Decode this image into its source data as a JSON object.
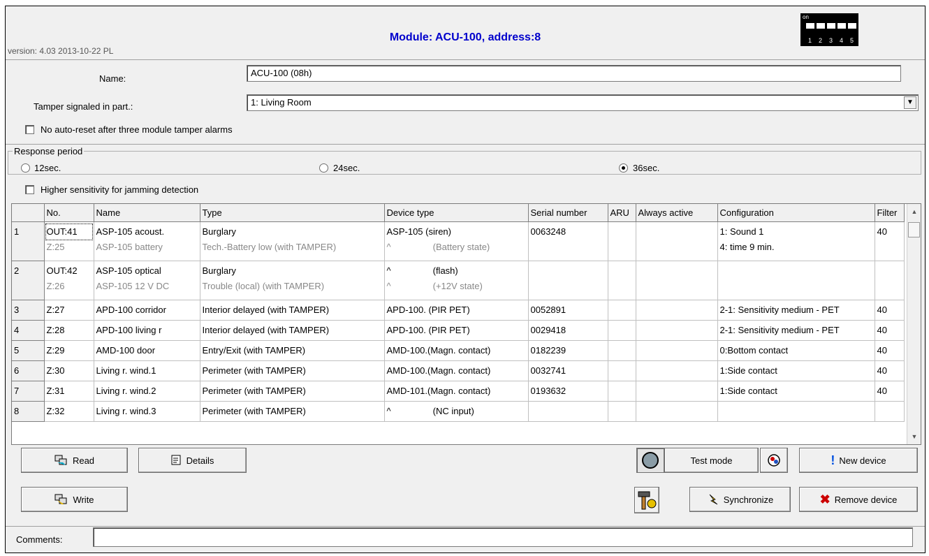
{
  "header": {
    "title": "Module: ACU-100, address:8",
    "version": "version: 4.03 2013-10-22 PL",
    "dip": {
      "on_label": "on",
      "numbers": [
        "1",
        "2",
        "3",
        "4",
        "5"
      ]
    }
  },
  "form": {
    "name_label": "Name:",
    "name_value": "ACU-100  (08h)",
    "tamper_label": "Tamper signaled in part.:",
    "tamper_value": "1: Living Room",
    "no_autoreset_label": "No auto-reset after three module tamper alarms",
    "response_period_label": "Response period",
    "response_options": [
      "12sec.",
      "24sec.",
      "36sec."
    ],
    "response_selected": "36sec.",
    "higher_sensitivity_label": "Higher sensitivity for jamming detection"
  },
  "table": {
    "headers": [
      "",
      "No.",
      "Name",
      "Type",
      "Device type",
      "Serial number",
      "ARU",
      "Always active",
      "Configuration",
      "Filter"
    ],
    "rows": [
      {
        "n": "1",
        "no": "OUT:41",
        "name": "ASP-105 acoust.",
        "type": "Burglary",
        "device": "ASP-105 (siren)",
        "serial": "0063248",
        "aru": "",
        "always": "",
        "config": "1: Sound 1",
        "filter": "40",
        "no2": "Z:25",
        "name2": "ASP-105 battery",
        "type2": "Tech.-Battery low (with TAMPER)",
        "device2a": "^",
        "device2b": "(Battery state)",
        "config2": "4: time 9 min."
      },
      {
        "n": "2",
        "no": "OUT:42",
        "name": "ASP-105 optical",
        "type": "Burglary",
        "device_a": "^",
        "device_b": "(flash)",
        "serial": "",
        "aru": "",
        "always": "",
        "config": "",
        "filter": "",
        "no2": "Z:26",
        "name2": "ASP-105 12 V DC",
        "type2": "Trouble (local) (with TAMPER)",
        "device2a": "^",
        "device2b": "(+12V state)",
        "config2": ""
      },
      {
        "n": "3",
        "no": "Z:27",
        "name": "APD-100 corridor",
        "type": "Interior delayed (with TAMPER)",
        "device": "APD-100. (PIR PET)",
        "serial": "0052891",
        "aru": "",
        "always": "",
        "config": "2-1: Sensitivity medium - PET",
        "filter": "40"
      },
      {
        "n": "4",
        "no": "Z:28",
        "name": "APD-100 living r",
        "type": "Interior delayed (with TAMPER)",
        "device": "APD-100. (PIR PET)",
        "serial": "0029418",
        "aru": "",
        "always": "",
        "config": "2-1: Sensitivity medium - PET",
        "filter": "40"
      },
      {
        "n": "5",
        "no": "Z:29",
        "name": "AMD-100 door",
        "type": "Entry/Exit (with TAMPER)",
        "device": "AMD-100.(Magn. contact)",
        "serial": "0182239",
        "aru": "",
        "always": "",
        "config": "0:Bottom contact",
        "filter": "40"
      },
      {
        "n": "6",
        "no": "Z:30",
        "name": "Living r. wind.1",
        "type": "Perimeter (with TAMPER)",
        "device": "AMD-100.(Magn. contact)",
        "serial": "0032741",
        "aru": "",
        "always": "",
        "config": "1:Side contact",
        "filter": "40"
      },
      {
        "n": "7",
        "no": "Z:31",
        "name": "Living r. wind.2",
        "type": "Perimeter (with TAMPER)",
        "device": "AMD-101.(Magn. contact)",
        "serial": "0193632",
        "aru": "",
        "always": "",
        "config": "1:Side contact",
        "filter": "40"
      },
      {
        "n": "8",
        "no": "Z:32",
        "name": "Living r. wind.3",
        "type": "Perimeter (with TAMPER)",
        "device_a": "^",
        "device_b": "(NC input)",
        "serial": "",
        "aru": "",
        "always": "",
        "config": "",
        "filter": ""
      }
    ]
  },
  "buttons": {
    "read": "Read",
    "details": "Details",
    "write": "Write",
    "test_mode": "Test mode",
    "new_device": "New device",
    "synchronize": "Synchronize",
    "remove_device": "Remove device"
  },
  "comments": {
    "label": "Comments:",
    "value": ""
  },
  "colors": {
    "title": "#0000cc",
    "background": "#f0f0f0",
    "remove_x": "#cc0000"
  }
}
